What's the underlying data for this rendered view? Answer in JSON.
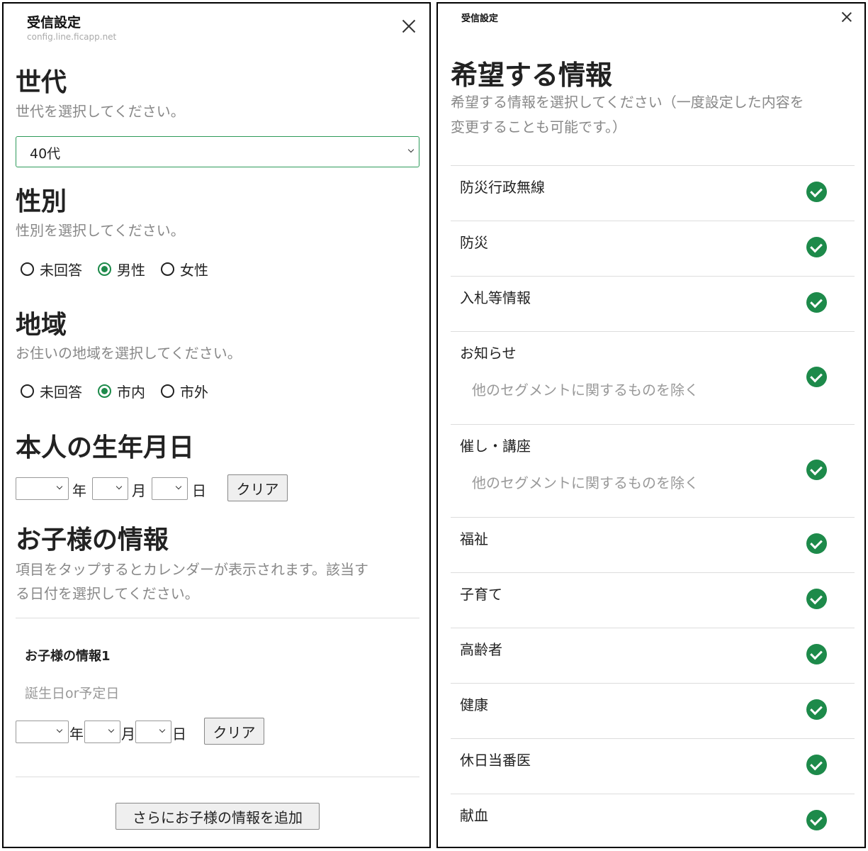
{
  "left": {
    "title": "受信設定",
    "subtitle": "config.line.ficapp.net",
    "generation": {
      "heading": "世代",
      "description": "世代を選択してください。",
      "selected": "40代"
    },
    "gender": {
      "heading": "性別",
      "description": "性別を選択してください。",
      "options": [
        "未回答",
        "男性",
        "女性"
      ],
      "selected": "男性"
    },
    "region": {
      "heading": "地域",
      "description": "お住いの地域を選択してください。",
      "options": [
        "未回答",
        "市内",
        "市外"
      ],
      "selected": "市内"
    },
    "birthday": {
      "heading": "本人の生年月日",
      "year_unit": "年",
      "month_unit": "月",
      "day_unit": "日",
      "clear_label": "クリア"
    },
    "children": {
      "heading": "お子様の情報",
      "description_line1": "項目をタップするとカレンダーが表示されます。該当す",
      "description_line2": "る日付を選択してください。",
      "child1": {
        "title": "お子様の情報1",
        "subtitle": "誕生日or予定日",
        "year_unit": "年",
        "month_unit": "月",
        "day_unit": "日",
        "clear_label": "クリア"
      },
      "add_label": "さらにお子様の情報を追加"
    }
  },
  "right": {
    "title": "受信設定",
    "heading": "希望する情報",
    "description_line1": "希望する情報を選択してください（一度設定した内容を",
    "description_line2": "変更することも可能です。）",
    "items": [
      {
        "name": "防災行政無線",
        "note": "",
        "checked": true
      },
      {
        "name": "防災",
        "note": "",
        "checked": true
      },
      {
        "name": "入札等情報",
        "note": "",
        "checked": true
      },
      {
        "name": "お知らせ",
        "note": "他のセグメントに関するものを除く",
        "checked": true
      },
      {
        "name": "催し・講座",
        "note": "他のセグメントに関するものを除く",
        "checked": true
      },
      {
        "name": "福祉",
        "note": "",
        "checked": true
      },
      {
        "name": "子育て",
        "note": "",
        "checked": true
      },
      {
        "name": "高齢者",
        "note": "",
        "checked": true
      },
      {
        "name": "健康",
        "note": "",
        "checked": true
      },
      {
        "name": "休日当番医",
        "note": "",
        "checked": true
      },
      {
        "name": "献血",
        "note": "",
        "checked": true
      }
    ],
    "check_color": "#1d8a4a"
  }
}
